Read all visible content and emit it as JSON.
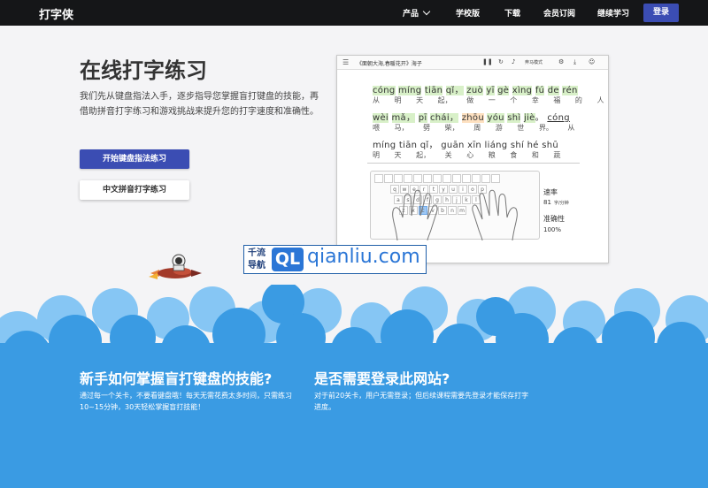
{
  "nav": {
    "logo": "打字侠",
    "items": [
      {
        "label": "产品"
      },
      {
        "label": "学校版"
      },
      {
        "label": "下载"
      },
      {
        "label": "会员订阅"
      },
      {
        "label": "继续学习"
      }
    ],
    "login": "登录"
  },
  "hero": {
    "title": "在线打字练习",
    "description": "我们先从键盘指法入手，逐步指导您掌握盲打键盘的技能，再借助拼音打字练习和游戏挑战来提升您的打字速度和准确性。",
    "primary_button": "开始键盘指法练习",
    "secondary_button": "中文拼音打字练习"
  },
  "preview": {
    "menu_icon": "☰",
    "doc_title": "《面朝大海,春暖花开》海子",
    "controls": "奔马模式",
    "pinyin_1": [
      "cóng",
      "míng",
      "tiān",
      "qǐ",
      "，",
      "zuò",
      "yī",
      "gè",
      "xìng",
      "fú",
      "de",
      "rén"
    ],
    "hanzi_1": [
      "从",
      "明",
      "天",
      "起",
      "，",
      "做",
      "一",
      "个",
      "幸",
      "福",
      "的",
      "人"
    ],
    "pinyin_2": [
      "wèi",
      "mǎ",
      "，",
      "pī",
      "chái",
      "，",
      "zhōu",
      "yóu",
      "shì",
      "jiè",
      "。",
      "cóng"
    ],
    "hanzi_2": [
      "喂",
      "马",
      "，",
      "劈",
      "柴",
      "，",
      "周",
      "游",
      "世",
      "界",
      "。",
      "从"
    ],
    "pinyin_3": [
      "míng",
      "tiān",
      "qǐ",
      "，",
      "guān",
      "xīn",
      "liáng",
      "shí",
      "hé",
      "shū"
    ],
    "hanzi_3": [
      "明",
      "天",
      "起",
      "，",
      "关",
      "心",
      "粮",
      "食",
      "和",
      "蔬"
    ],
    "keys_row1": [
      "q",
      "w",
      "e",
      "r",
      "t",
      "y",
      "u",
      "i",
      "o",
      "p"
    ],
    "keys_row2": [
      "a",
      "s",
      "d",
      "f",
      "g",
      "h",
      "j",
      "k",
      "l"
    ],
    "keys_row3": [
      "z",
      "x",
      "c",
      "v",
      "b",
      "n",
      "m"
    ],
    "speed_label": "速率",
    "speed_value": "81",
    "speed_unit": "字/分钟",
    "accuracy_label": "准确性",
    "accuracy_value": "100%"
  },
  "watermark": {
    "cn_line1": "千流",
    "cn_line2": "导航",
    "ql": "QL",
    "domain": "qianliu.com"
  },
  "faq": [
    {
      "title": "新手如何掌握盲打键盘的技能?",
      "text": "通过每一个关卡，不要看键盘哦！每天无需花费太多时间，只需练习10~15分钟，30天轻松掌握盲打技能！"
    },
    {
      "title": "是否需要登录此网站?",
      "text": "对于前20关卡，用户无需登录；但后续课程需要先登录才能保存打字进度。"
    }
  ],
  "colors": {
    "primary": "#3b4db3",
    "sky_blue": "#3a9be3",
    "cloud_light": "#86c6f4",
    "nav_bg": "#151618"
  }
}
